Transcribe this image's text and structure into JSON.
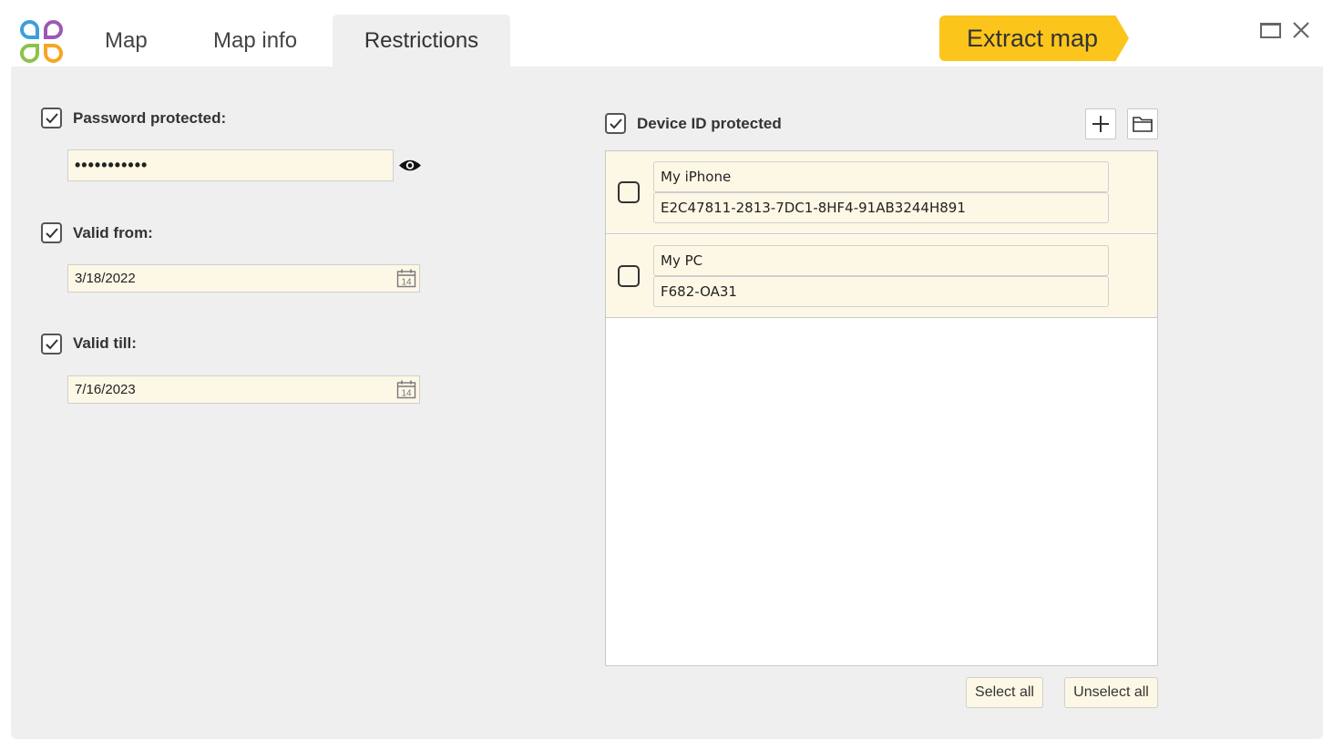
{
  "tabs": [
    {
      "label": "Map",
      "active": false
    },
    {
      "label": "Map info",
      "active": false
    },
    {
      "label": "Restrictions",
      "active": true
    }
  ],
  "extract_button": "Extract map",
  "password": {
    "checked": true,
    "label": "Password protected:",
    "value": "•••••••••••"
  },
  "valid_from": {
    "checked": true,
    "label": "Valid from:",
    "value": "3/18/2022"
  },
  "valid_till": {
    "checked": true,
    "label": "Valid till:",
    "value": "7/16/2023"
  },
  "calendar_icon_text": "14",
  "device": {
    "checked": true,
    "label": "Device ID protected",
    "items": [
      {
        "name": "My iPhone",
        "id": "E2C47811-2813-7DC1-8HF4-91AB3244H891",
        "checked": false
      },
      {
        "name": "My PC",
        "id": "F682-OA31",
        "checked": false
      }
    ]
  },
  "buttons": {
    "select_all": "Select all",
    "unselect_all": "Unselect all"
  },
  "colors": {
    "accent": "#fbc51c",
    "field_bg": "#fdf8e6",
    "panel_bg": "#efefef"
  },
  "icons": [
    "app-logo",
    "eye-icon",
    "calendar-icon",
    "plus-icon",
    "folder-icon",
    "maximize-icon",
    "close-icon",
    "checkmark-icon"
  ]
}
